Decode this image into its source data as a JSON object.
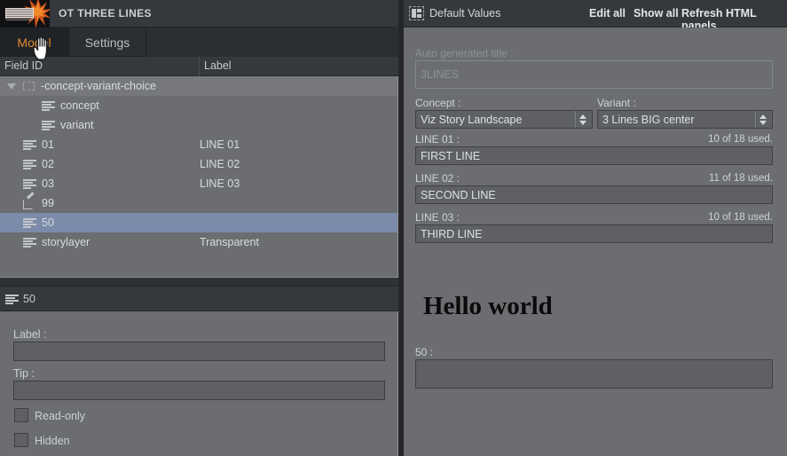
{
  "app": {
    "title": "OT THREE LINES",
    "logo_icon": "viz-splash-logo"
  },
  "tabs": [
    {
      "label": "Model",
      "active": true
    },
    {
      "label": "Settings",
      "active": false
    }
  ],
  "tree": {
    "columns": [
      "Field ID",
      "Label"
    ],
    "rows": [
      {
        "field_id": "-concept-variant-choice",
        "label": "",
        "icon": "dashed-box-icon",
        "indent": 0,
        "group": true,
        "expanded": true,
        "selected": false
      },
      {
        "field_id": "concept",
        "label": "",
        "icon": "text-lines-icon",
        "indent": 2,
        "group": false,
        "selected": false
      },
      {
        "field_id": "variant",
        "label": "",
        "icon": "text-lines-icon",
        "indent": 2,
        "group": false,
        "selected": false
      },
      {
        "field_id": "01",
        "label": "LINE 01",
        "icon": "text-lines-icon",
        "indent": 1,
        "group": false,
        "selected": false
      },
      {
        "field_id": "02",
        "label": "LINE 02",
        "icon": "text-lines-icon",
        "indent": 1,
        "group": false,
        "selected": false
      },
      {
        "field_id": "03",
        "label": "LINE 03",
        "icon": "text-lines-icon",
        "indent": 1,
        "group": false,
        "selected": false
      },
      {
        "field_id": "99",
        "label": "",
        "icon": "pencil-edit-icon",
        "indent": 1,
        "group": false,
        "selected": false
      },
      {
        "field_id": "50",
        "label": "",
        "icon": "text-lines-icon",
        "indent": 1,
        "group": false,
        "selected": true
      },
      {
        "field_id": "storylayer",
        "label": "Transparent",
        "icon": "text-lines-icon",
        "indent": 1,
        "group": false,
        "selected": false
      }
    ]
  },
  "detail": {
    "header_title": "50",
    "header_icon": "text-lines-icon",
    "label_field": {
      "label": "Label :",
      "value": "",
      "placeholder": ""
    },
    "tip_field": {
      "label": "Tip :",
      "value": "",
      "placeholder": ""
    },
    "checkboxes": [
      {
        "label": "Read-only",
        "checked": false
      },
      {
        "label": "Hidden",
        "checked": false
      }
    ]
  },
  "right": {
    "title": "Default Values",
    "title_icon": "default-values-panel-icon",
    "actions": [
      {
        "label": "Edit all"
      },
      {
        "label": "Show all"
      },
      {
        "label": "Refresh HTML panels"
      }
    ],
    "auto_title": {
      "label": "Auto generated title :",
      "value": "3LINES",
      "disabled": true
    },
    "concept": {
      "label": "Concept :",
      "value": "Viz Story Landscape"
    },
    "variant": {
      "label": "Variant :",
      "value": "3 Lines BIG center"
    },
    "lines": [
      {
        "label": "LINE 01 :",
        "value": "FIRST LINE",
        "count": "10 of 18 used."
      },
      {
        "label": "LINE 02 :",
        "value": "SECOND LINE",
        "count": "11 of 18 used."
      },
      {
        "label": "LINE 03 :",
        "value": "THIRD LINE",
        "count": "10 of 18 used."
      }
    ],
    "preview_text": "Hello world",
    "field50": {
      "label": "50 :",
      "value": ""
    }
  },
  "colors": {
    "accent": "#e08a2e",
    "selection": "#7b8ba9",
    "panel_bg": "#6b6d71",
    "chrome_bg": "#35383d",
    "dark_bg": "#2b2e33"
  },
  "cursor": {
    "icon": "pointing-hand-cursor"
  }
}
